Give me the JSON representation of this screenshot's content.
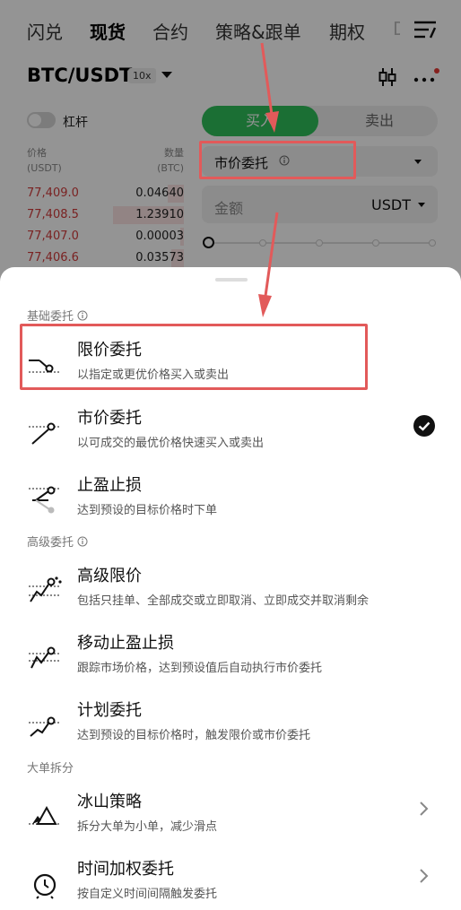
{
  "nav": {
    "items": [
      "闪兑",
      "现货",
      "合约",
      "策略&跟单",
      "期权",
      "D"
    ],
    "active_index": 1
  },
  "pair": {
    "name": "BTC/USDT",
    "leverage": "10x"
  },
  "margin_toggle": {
    "label": "杠杆",
    "on": false
  },
  "order_book": {
    "price_header": "价格\n(USDT)",
    "qty_header": "数量\n(BTC)",
    "rows": [
      {
        "price": "77,409.0",
        "qty": "0.04640",
        "depth": 0.1
      },
      {
        "price": "77,408.5",
        "qty": "1.23910",
        "depth": 0.45
      },
      {
        "price": "77,407.0",
        "qty": "0.00003",
        "depth": 0.02
      },
      {
        "price": "77,406.6",
        "qty": "0.03573",
        "depth": 0.08
      }
    ]
  },
  "trade": {
    "buy_label": "买入",
    "sell_label": "卖出",
    "order_type": "市价委托",
    "amount_placeholder": "金额",
    "amount_unit": "USDT"
  },
  "sheet": {
    "sections": [
      {
        "title": "基础委托",
        "has_info": true,
        "options": [
          {
            "title": "限价委托",
            "desc": "以指定或更优价格买入或卖出",
            "icon": "limit-order-icon",
            "selected": false,
            "chevron": false
          },
          {
            "title": "市价委托",
            "desc": "以可成交的最优价格快速买入或卖出",
            "icon": "market-order-icon",
            "selected": true,
            "chevron": false
          },
          {
            "title": "止盈止损",
            "desc": "达到预设的目标价格时下单",
            "icon": "tp-sl-icon",
            "selected": false,
            "chevron": false
          }
        ]
      },
      {
        "title": "高级委托",
        "has_info": true,
        "options": [
          {
            "title": "高级限价",
            "desc": "包括只挂单、全部成交或立即取消、立即成交并取消剩余",
            "icon": "advanced-limit-icon",
            "selected": false,
            "chevron": false
          },
          {
            "title": "移动止盈止损",
            "desc": "跟踪市场价格，达到预设值后自动执行市价委托",
            "icon": "trailing-stop-icon",
            "selected": false,
            "chevron": false
          },
          {
            "title": "计划委托",
            "desc": "达到预设的目标价格时，触发限价或市价委托",
            "icon": "trigger-order-icon",
            "selected": false,
            "chevron": false
          }
        ]
      },
      {
        "title": "大单拆分",
        "has_info": false,
        "options": [
          {
            "title": "冰山策略",
            "desc": "拆分大单为小单，减少滑点",
            "icon": "iceberg-icon",
            "selected": false,
            "chevron": true
          },
          {
            "title": "时间加权委托",
            "desc": "按自定义时间间隔触发委托",
            "icon": "twap-clock-icon",
            "selected": false,
            "chevron": true
          }
        ]
      }
    ]
  },
  "colors": {
    "buy_green": "#2fbf5b",
    "ask_red": "#d23c3c",
    "highlight": "#e25a5a"
  }
}
